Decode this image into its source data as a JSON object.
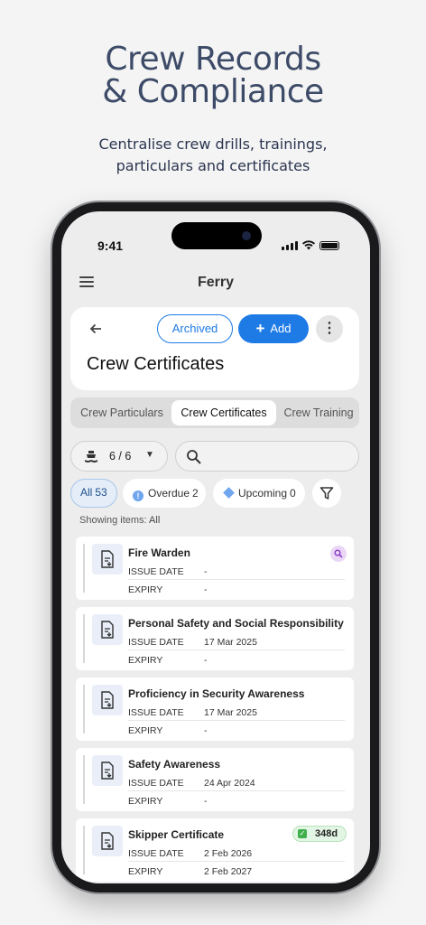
{
  "hero": {
    "title_line1": "Crew Records",
    "title_line2": "& Compliance",
    "subtitle_line1": "Centralise crew drills, trainings,",
    "subtitle_line2": "particulars and certificates"
  },
  "status_bar": {
    "time": "9:41"
  },
  "app_bar": {
    "title": "Ferry"
  },
  "header": {
    "archived_label": "Archived",
    "add_label": "Add",
    "more_label": "⋮",
    "title": "Crew Certificates"
  },
  "tabs": [
    {
      "label": "Crew Particulars"
    },
    {
      "label": "Crew Certificates"
    },
    {
      "label": "Crew Training"
    }
  ],
  "vessel_filter": {
    "value": "6 / 6"
  },
  "search": {
    "placeholder": ""
  },
  "chips": {
    "all": {
      "label": "All",
      "count": "53"
    },
    "overdue": {
      "label": "Overdue",
      "count": "2"
    },
    "upcoming": {
      "label": "Upcoming",
      "count": "0"
    }
  },
  "showing": {
    "prefix": "Showing items:",
    "value": "All"
  },
  "labels": {
    "issue_date": "ISSUE DATE",
    "expiry": "EXPIRY"
  },
  "certificates": [
    {
      "name": "Fire Warden",
      "issue_date": "-",
      "expiry": "-"
    },
    {
      "name": "Personal Safety and Social Responsibility",
      "issue_date": "17 Mar 2025",
      "expiry": "-"
    },
    {
      "name": "Proficiency in Security Awareness",
      "issue_date": "17 Mar 2025",
      "expiry": "-"
    },
    {
      "name": "Safety Awareness",
      "issue_date": "24 Apr 2024",
      "expiry": "-"
    },
    {
      "name": "Skipper Certificate",
      "issue_date": "2 Feb 2026",
      "expiry": "2 Feb 2027",
      "days_badge": "348d"
    }
  ],
  "colors": {
    "accent": "#1e7be6",
    "hero_title": "#3d4b68",
    "badge_green": "#3fb04b"
  }
}
